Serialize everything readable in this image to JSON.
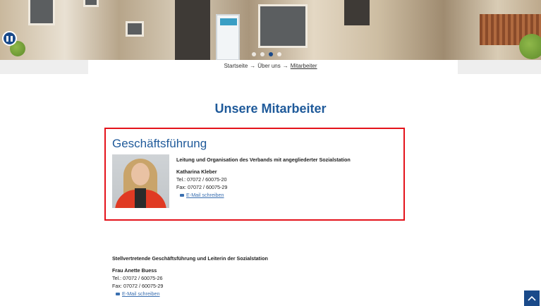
{
  "slider": {
    "dot_count": 4,
    "active_dot": 3
  },
  "breadcrumb": {
    "items": [
      "Startseite",
      "Über uns",
      "Mitarbeiter"
    ],
    "separator": "→"
  },
  "page_title": "Unsere Mitarbeiter",
  "sections": [
    {
      "title": "Geschäftsführung",
      "description": "Leitung und Organisation des Verbands mit angegliederter Sozialstation",
      "name": "Katharina Kleber",
      "phone": "Tel.: 07072 / 60075-20",
      "fax": "Fax: 07072 / 60075-29",
      "email_label": "E-Mail schreiben"
    },
    {
      "description": "Stellvertretende Geschäftsführung und Leiterin der Sozialstation",
      "name": "Frau Anette Buess",
      "phone": "Tel.: 07072 / 60075-26",
      "fax": "Fax: 07072 / 60075-29",
      "email_label": "E-Mail schreiben"
    }
  ],
  "colors": {
    "primary_blue": "#1f5a9a",
    "highlight_red": "#e4131b",
    "link_blue": "#3a6fb0"
  },
  "icons": {
    "pause": "pause-icon",
    "mail": "mail-icon",
    "back_to_top": "chevron-up-icon"
  }
}
